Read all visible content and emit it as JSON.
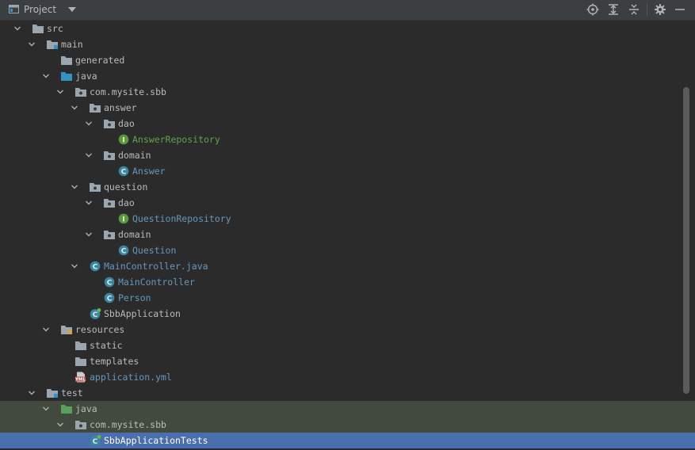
{
  "header": {
    "title": "Project",
    "icons": [
      "project-window-icon",
      "dropdown-arrow-icon",
      "locate-icon",
      "expand-all-icon",
      "collapse-all-icon",
      "gear-icon",
      "hide-icon"
    ]
  },
  "colors": {
    "background": "#2b2b2b",
    "header": "#3c3f41",
    "selection": "#4b6eaf",
    "test_root_highlight": "#424a3e",
    "folder": "#9aa7b0",
    "source_folder": "#3592c4",
    "test_folder": "#5aa05a",
    "class_icon": "#3e86a0",
    "interface_icon": "#5a9a3a"
  },
  "tree": [
    {
      "label": "src",
      "level": 0,
      "expanded": true,
      "icon": "folder-icon",
      "style": "white"
    },
    {
      "label": "main",
      "level": 1,
      "expanded": true,
      "icon": "module-folder-icon",
      "style": "white"
    },
    {
      "label": "generated",
      "level": 2,
      "expanded": null,
      "icon": "folder-icon",
      "style": "white"
    },
    {
      "label": "java",
      "level": 2,
      "expanded": true,
      "icon": "source-folder-icon",
      "style": "white"
    },
    {
      "label": "com.mysite.sbb",
      "level": 3,
      "expanded": true,
      "icon": "package-icon",
      "style": "white"
    },
    {
      "label": "answer",
      "level": 4,
      "expanded": true,
      "icon": "package-icon",
      "style": "white"
    },
    {
      "label": "dao",
      "level": 5,
      "expanded": true,
      "icon": "package-icon",
      "style": "white"
    },
    {
      "label": "AnswerRepository",
      "level": 6,
      "expanded": null,
      "icon": "interface-icon",
      "style": "green"
    },
    {
      "label": "domain",
      "level": 5,
      "expanded": true,
      "icon": "package-icon",
      "style": "white"
    },
    {
      "label": "Answer",
      "level": 6,
      "expanded": null,
      "icon": "class-icon",
      "style": "blue"
    },
    {
      "label": "question",
      "level": 4,
      "expanded": true,
      "icon": "package-icon",
      "style": "white"
    },
    {
      "label": "dao",
      "level": 5,
      "expanded": true,
      "icon": "package-icon",
      "style": "white"
    },
    {
      "label": "QuestionRepository",
      "level": 6,
      "expanded": null,
      "icon": "interface-icon",
      "style": "blue"
    },
    {
      "label": "domain",
      "level": 5,
      "expanded": true,
      "icon": "package-icon",
      "style": "white"
    },
    {
      "label": "Question",
      "level": 6,
      "expanded": null,
      "icon": "class-icon",
      "style": "blue"
    },
    {
      "label": "MainController.java",
      "level": 4,
      "expanded": true,
      "icon": "class-icon",
      "style": "blue"
    },
    {
      "label": "MainController",
      "level": 5,
      "expanded": null,
      "icon": "class-icon",
      "style": "blue"
    },
    {
      "label": "Person",
      "level": 5,
      "expanded": null,
      "icon": "class-icon",
      "style": "blue"
    },
    {
      "label": "SbbApplication",
      "level": 4,
      "expanded": null,
      "icon": "spring-class-icon",
      "style": "white"
    },
    {
      "label": "resources",
      "level": 2,
      "expanded": true,
      "icon": "resources-folder-icon",
      "style": "white"
    },
    {
      "label": "static",
      "level": 3,
      "expanded": null,
      "icon": "folder-icon",
      "style": "white"
    },
    {
      "label": "templates",
      "level": 3,
      "expanded": null,
      "icon": "folder-icon",
      "style": "white"
    },
    {
      "label": "application.yml",
      "level": 3,
      "expanded": null,
      "icon": "yml-file-icon",
      "style": "blue"
    },
    {
      "label": "test",
      "level": 1,
      "expanded": true,
      "icon": "module-folder-icon",
      "style": "white"
    },
    {
      "label": "java",
      "level": 2,
      "expanded": true,
      "icon": "test-folder-icon",
      "style": "white",
      "highlight": "green"
    },
    {
      "label": "com.mysite.sbb",
      "level": 3,
      "expanded": true,
      "icon": "package-icon",
      "style": "white",
      "highlight": "green"
    },
    {
      "label": "SbbApplicationTests",
      "level": 4,
      "expanded": null,
      "icon": "spring-class-icon",
      "style": "white",
      "highlight": "selected"
    }
  ]
}
